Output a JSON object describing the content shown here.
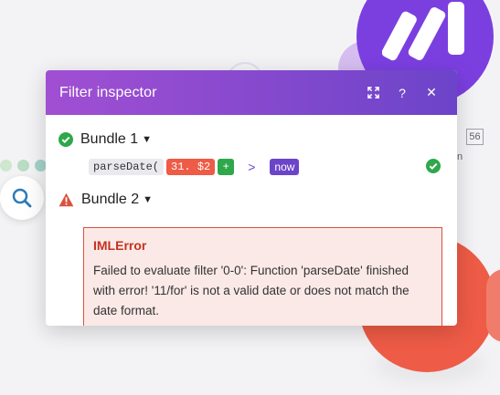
{
  "panel": {
    "title": "Filter inspector",
    "expand_icon": "expand-icon",
    "help_label": "?",
    "close_label": "✕"
  },
  "bundles": [
    {
      "label": "Bundle 1",
      "status": "success",
      "expression": {
        "function": "parseDate(",
        "variable": "31. $2",
        "plus": "+",
        "operator": ">",
        "keyword": "now"
      }
    },
    {
      "label": "Bundle 2",
      "status": "error",
      "error": {
        "title": "IMLError",
        "message": "Failed to evaluate filter '0-0': Function 'parseDate' finished with error! '11/for' is not a valid date or does not match the date format."
      }
    }
  ],
  "canvas": {
    "operation_count": "56",
    "side_letter": "n"
  },
  "colors": {
    "header_start": "#a14fd3",
    "header_end": "#6c44c9",
    "success": "#2ea84a",
    "error": "#d8533f",
    "variable_chip": "#ee5b46",
    "make_module": "#7b3fe0",
    "red_module": "#ee5b46"
  }
}
